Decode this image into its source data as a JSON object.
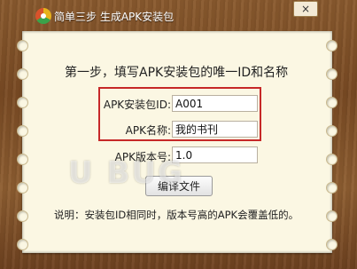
{
  "window": {
    "title": "简单三步  生成APK安装包",
    "close_label": "×",
    "logo_icon": "app-logo-icon"
  },
  "form": {
    "heading": "第一步，填写APK安装包的唯一ID和名称",
    "id_label": "APK安装包ID:",
    "id_value": "A001",
    "name_label": "APK名称:",
    "name_value": "我的书刊",
    "version_label": "APK版本号:",
    "version_value": "1.0",
    "compile_button": "编译文件",
    "note": "说明：安装包ID相同时，版本号高的APK会覆盖低的。"
  },
  "watermark": "U BUG",
  "colors": {
    "highlight_border": "#c62828",
    "paper": "#fbf7e3",
    "wood": "#7a4b24"
  }
}
